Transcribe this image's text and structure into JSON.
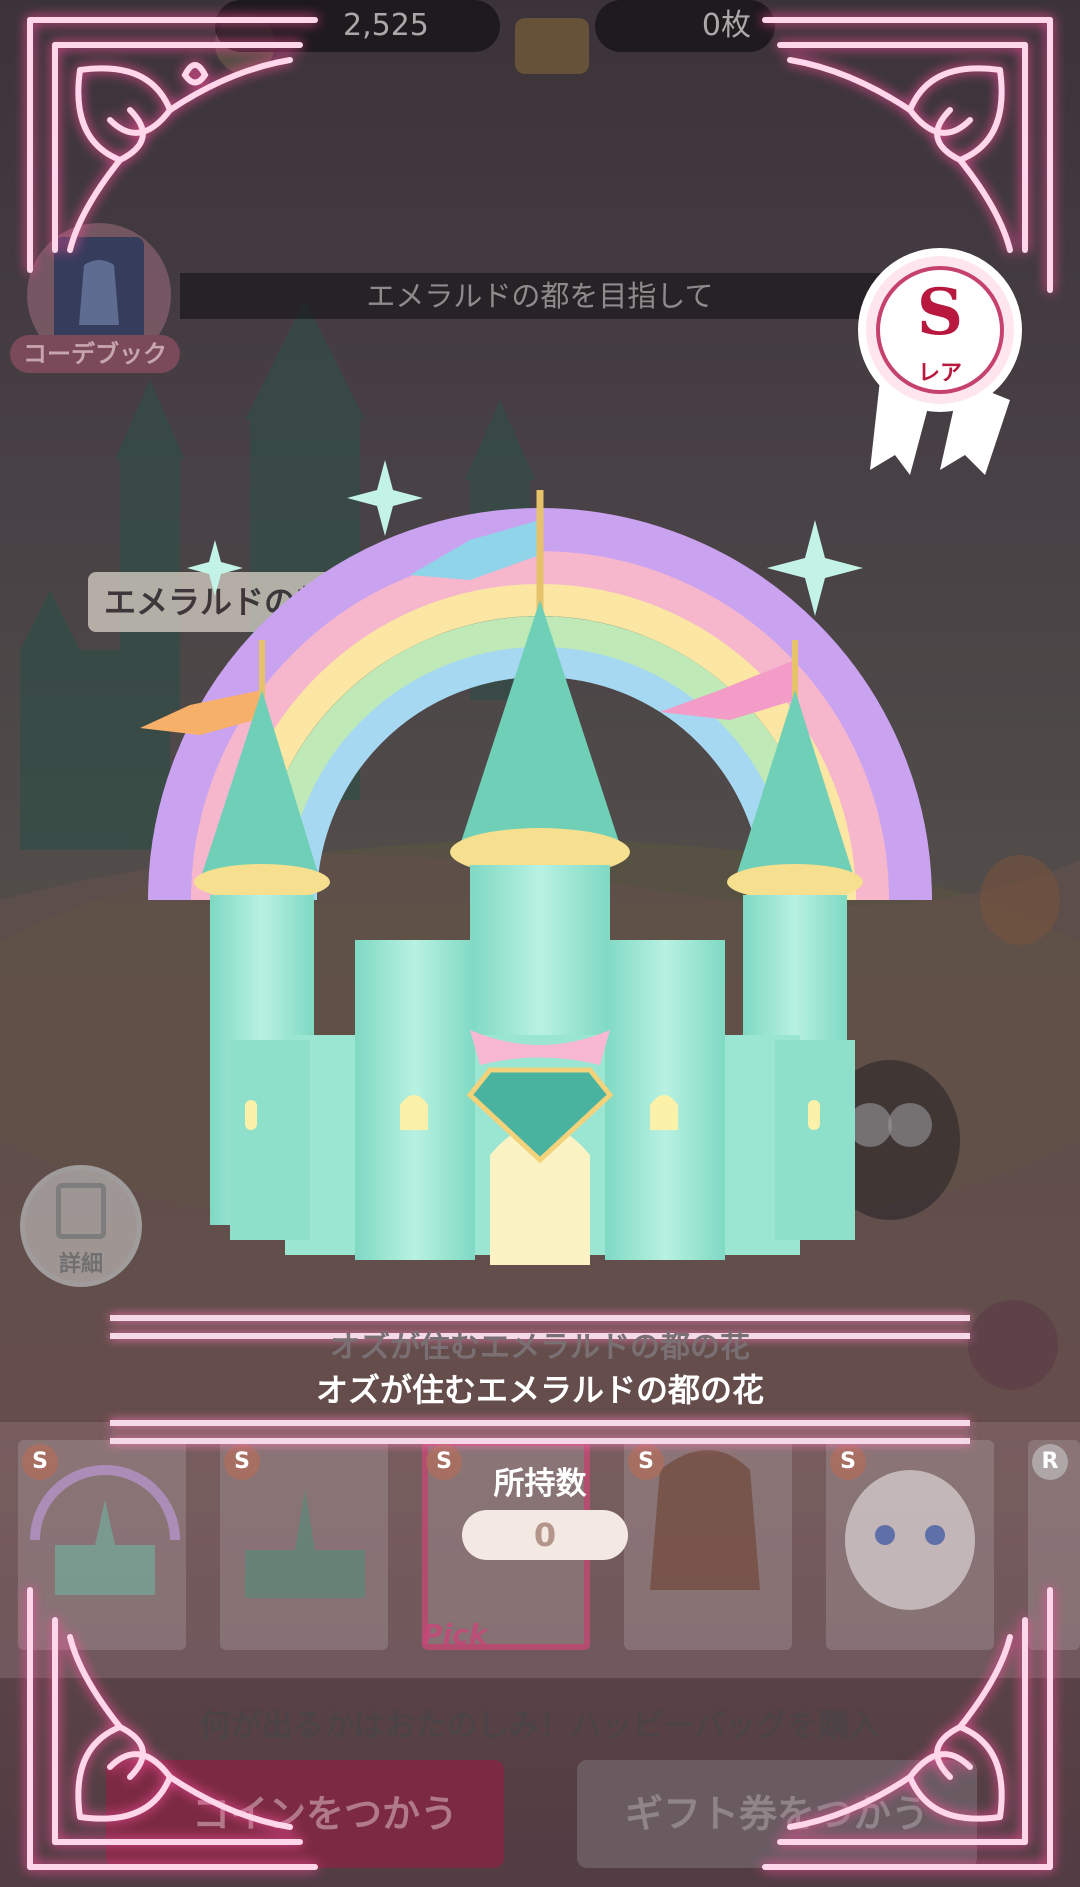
{
  "header": {
    "coin_count": "2,525",
    "ticket_count": "0枚",
    "codebook_label": "コーデブック",
    "page_title": "エメラルドの都を目指して"
  },
  "background": {
    "sign_text": "エメラルドの都",
    "detail_label": "詳細"
  },
  "reward": {
    "rarity_letter": "S",
    "rarity_label": "レア",
    "item_name_ghost": "オズが住むエメラルドの都の花",
    "item_name": "オズが住むエメラルドの都の花",
    "owned_label": "所持数",
    "owned_count": "0"
  },
  "item_strip": {
    "slots": [
      {
        "badge": "S",
        "icon": "castle-rainbow-thumbnail"
      },
      {
        "badge": "S",
        "icon": "castle-green-thumbnail"
      },
      {
        "badge": "S",
        "icon": "pick-item-thumbnail"
      },
      {
        "badge": "S",
        "icon": "wavy-hair-thumbnail"
      },
      {
        "badge": "S",
        "icon": "doll-face-thumbnail"
      },
      {
        "badge": "R",
        "icon": "partial-thumbnail"
      }
    ],
    "pick_label": "Pick"
  },
  "footer": {
    "promo_text": "何が出るかはおたのしみ！ハッピーバッグを購入",
    "coin_button_label": "コインをつかう",
    "gift_button_label": "ギフト券をつかう"
  },
  "colors": {
    "frame_pink": "#ff5fa8",
    "castle_mint": "#8fe3cf",
    "rainbow_purple": "#c9a3f0",
    "badge_red": "#b8183e"
  }
}
